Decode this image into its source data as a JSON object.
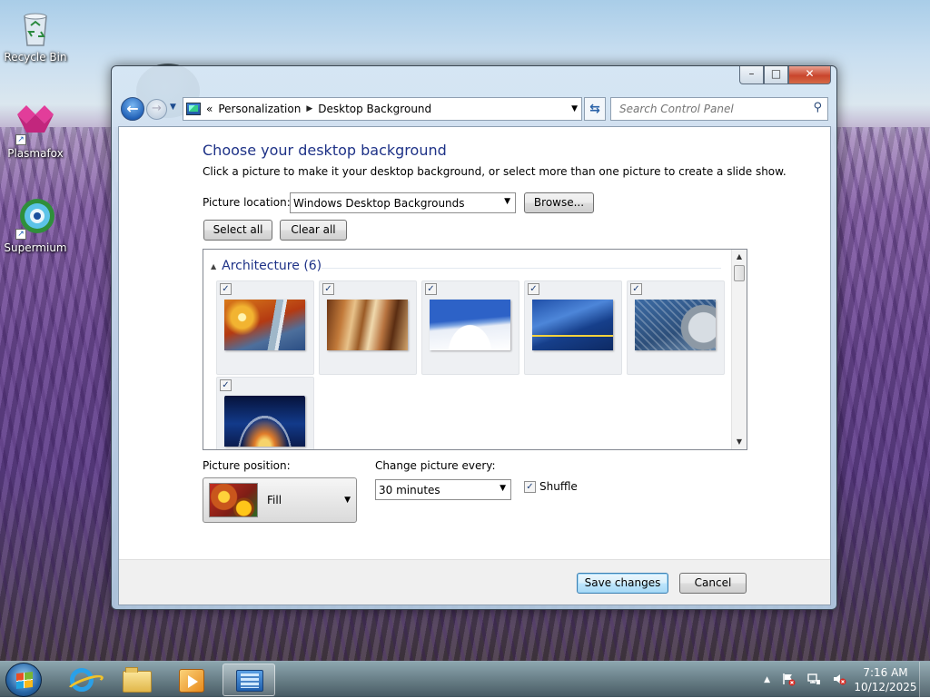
{
  "desktop": {
    "icons": [
      {
        "label": "Recycle Bin"
      },
      {
        "label": "Plasmafox"
      },
      {
        "label": "Supermium"
      }
    ]
  },
  "window": {
    "title_buttons": {
      "minimize": "–",
      "maximize": "□",
      "close": "✕"
    },
    "breadcrumbs": [
      "Personalization",
      "Desktop Background"
    ],
    "breadcrumb_prefix": "«",
    "search_placeholder": "Search Control Panel",
    "heading": "Choose your desktop background",
    "description": "Click a picture to make it your desktop background, or select more than one picture to create a slide show.",
    "picture_location_label": "Picture location:",
    "picture_location_value": "Windows Desktop Backgrounds",
    "browse_label": "Browse...",
    "select_all_label": "Select all",
    "clear_all_label": "Clear all",
    "gallery": {
      "group_name": "Architecture (6)",
      "items": [
        {
          "checked": "✓",
          "icon": "architecture-1"
        },
        {
          "checked": "✓",
          "icon": "architecture-2"
        },
        {
          "checked": "✓",
          "icon": "architecture-3"
        },
        {
          "checked": "✓",
          "icon": "architecture-4"
        },
        {
          "checked": "✓",
          "icon": "architecture-5"
        },
        {
          "checked": "✓",
          "icon": "architecture-6"
        }
      ]
    },
    "picture_position_label": "Picture position:",
    "picture_position_value": "Fill",
    "change_picture_label": "Change picture every:",
    "change_picture_value": "30 minutes",
    "shuffle_label": "Shuffle",
    "shuffle_checked": "✓",
    "save_label": "Save changes",
    "cancel_label": "Cancel"
  },
  "taskbar": {
    "apps": [
      "internet-explorer-icon",
      "file-explorer-icon",
      "media-player-icon",
      "control-panel-icon"
    ],
    "tray_arrow": "▲",
    "clock_time": "7:16 AM",
    "clock_date": "10/12/2025"
  }
}
